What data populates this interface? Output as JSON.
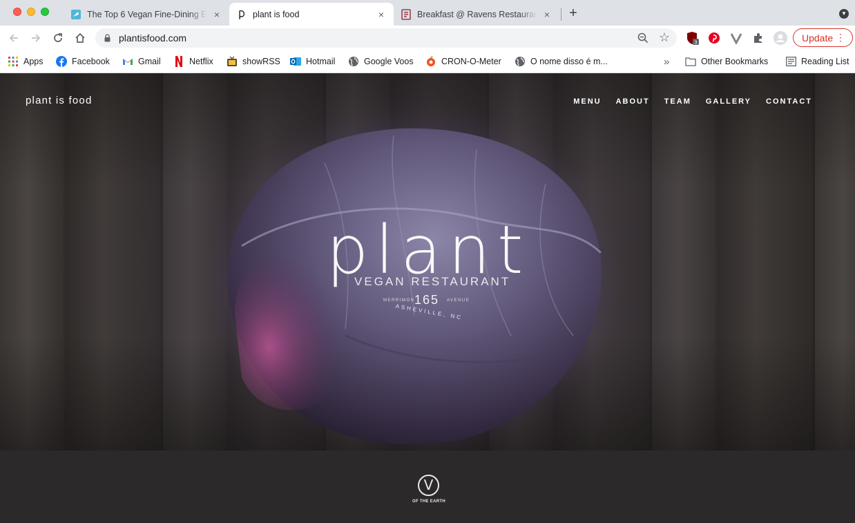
{
  "browser": {
    "tabs": [
      {
        "title": "The Top 6 Vegan Fine-Dining E",
        "close": "×"
      },
      {
        "title": "plant is food",
        "close": "×"
      },
      {
        "title": "Breakfast @ Ravens Restaurant",
        "close": "×"
      }
    ],
    "new_tab": "+",
    "url": "plantisfood.com",
    "update_label": "Update",
    "extension_badge": "3"
  },
  "bookmarks": {
    "items": [
      {
        "label": "Apps",
        "icon": "apps-grid-icon"
      },
      {
        "label": "Facebook",
        "icon": "facebook-icon"
      },
      {
        "label": "Gmail",
        "icon": "gmail-icon"
      },
      {
        "label": "Netflix",
        "icon": "netflix-icon"
      },
      {
        "label": "showRSS",
        "icon": "rss-icon"
      },
      {
        "label": "Hotmail",
        "icon": "outlook-icon"
      },
      {
        "label": "Google Voos",
        "icon": "globe-icon"
      },
      {
        "label": "CRON-O-Meter",
        "icon": "cronometer-icon"
      },
      {
        "label": "O nome disso é m...",
        "icon": "globe-icon"
      }
    ],
    "overflow": "»",
    "other_bookmarks": "Other Bookmarks",
    "reading_list": "Reading List"
  },
  "site": {
    "brand": "plant is food",
    "nav": [
      "MENU",
      "ABOUT",
      "TEAM",
      "GALLERY",
      "CONTACT"
    ],
    "logo": {
      "word": "plant",
      "subtitle": "VEGAN RESTAURANT",
      "number": "165",
      "left_small": "MERRIMON",
      "right_small": "AVENUE",
      "city": "ASHEVILLE, NC"
    },
    "footer": {
      "mark": "V",
      "caption": "OF THE EARTH"
    }
  },
  "colors": {
    "tabstrip": "#dee1e6",
    "update_red": "#d93025",
    "footer_band": "#2b2929"
  }
}
